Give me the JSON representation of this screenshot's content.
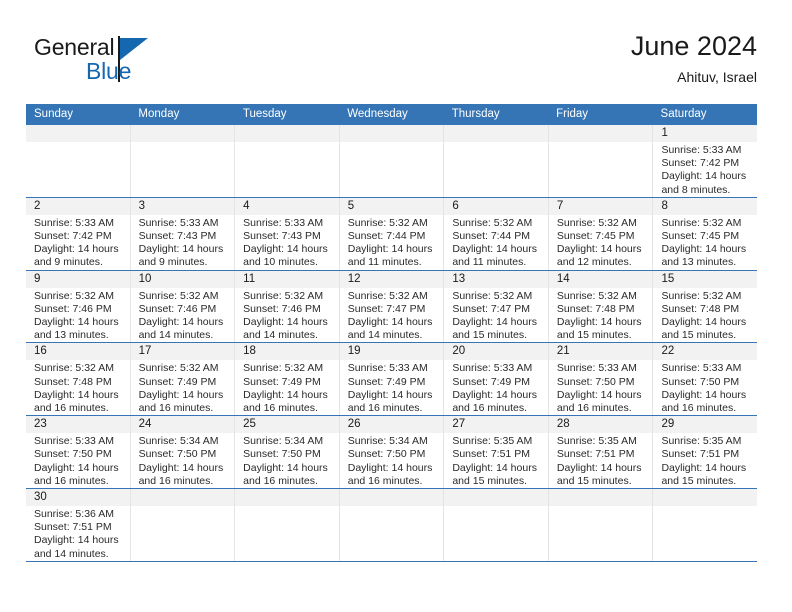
{
  "brand": {
    "name_top": "General",
    "name_bottom": "Blue",
    "triangle_icon": "triangle-icon",
    "accent_color": "#1567b0"
  },
  "header": {
    "month_title": "June 2024",
    "location": "Ahituv, Israel"
  },
  "theme": {
    "header_blue": "#3575b5",
    "daynum_band": "#f2f2f2",
    "text": "#1a1a1a"
  },
  "calendar": {
    "weekday_headers": [
      "Sunday",
      "Monday",
      "Tuesday",
      "Wednesday",
      "Thursday",
      "Friday",
      "Saturday"
    ],
    "weeks": [
      [
        {
          "day": "",
          "empty": true
        },
        {
          "day": "",
          "empty": true
        },
        {
          "day": "",
          "empty": true
        },
        {
          "day": "",
          "empty": true
        },
        {
          "day": "",
          "empty": true
        },
        {
          "day": "",
          "empty": true
        },
        {
          "day": "1",
          "sunrise": "Sunrise: 5:33 AM",
          "sunset": "Sunset: 7:42 PM",
          "daylight1": "Daylight: 14 hours",
          "daylight2": "and 8 minutes."
        }
      ],
      [
        {
          "day": "2",
          "sunrise": "Sunrise: 5:33 AM",
          "sunset": "Sunset: 7:42 PM",
          "daylight1": "Daylight: 14 hours",
          "daylight2": "and 9 minutes."
        },
        {
          "day": "3",
          "sunrise": "Sunrise: 5:33 AM",
          "sunset": "Sunset: 7:43 PM",
          "daylight1": "Daylight: 14 hours",
          "daylight2": "and 9 minutes."
        },
        {
          "day": "4",
          "sunrise": "Sunrise: 5:33 AM",
          "sunset": "Sunset: 7:43 PM",
          "daylight1": "Daylight: 14 hours",
          "daylight2": "and 10 minutes."
        },
        {
          "day": "5",
          "sunrise": "Sunrise: 5:32 AM",
          "sunset": "Sunset: 7:44 PM",
          "daylight1": "Daylight: 14 hours",
          "daylight2": "and 11 minutes."
        },
        {
          "day": "6",
          "sunrise": "Sunrise: 5:32 AM",
          "sunset": "Sunset: 7:44 PM",
          "daylight1": "Daylight: 14 hours",
          "daylight2": "and 11 minutes."
        },
        {
          "day": "7",
          "sunrise": "Sunrise: 5:32 AM",
          "sunset": "Sunset: 7:45 PM",
          "daylight1": "Daylight: 14 hours",
          "daylight2": "and 12 minutes."
        },
        {
          "day": "8",
          "sunrise": "Sunrise: 5:32 AM",
          "sunset": "Sunset: 7:45 PM",
          "daylight1": "Daylight: 14 hours",
          "daylight2": "and 13 minutes."
        }
      ],
      [
        {
          "day": "9",
          "sunrise": "Sunrise: 5:32 AM",
          "sunset": "Sunset: 7:46 PM",
          "daylight1": "Daylight: 14 hours",
          "daylight2": "and 13 minutes."
        },
        {
          "day": "10",
          "sunrise": "Sunrise: 5:32 AM",
          "sunset": "Sunset: 7:46 PM",
          "daylight1": "Daylight: 14 hours",
          "daylight2": "and 14 minutes."
        },
        {
          "day": "11",
          "sunrise": "Sunrise: 5:32 AM",
          "sunset": "Sunset: 7:46 PM",
          "daylight1": "Daylight: 14 hours",
          "daylight2": "and 14 minutes."
        },
        {
          "day": "12",
          "sunrise": "Sunrise: 5:32 AM",
          "sunset": "Sunset: 7:47 PM",
          "daylight1": "Daylight: 14 hours",
          "daylight2": "and 14 minutes."
        },
        {
          "day": "13",
          "sunrise": "Sunrise: 5:32 AM",
          "sunset": "Sunset: 7:47 PM",
          "daylight1": "Daylight: 14 hours",
          "daylight2": "and 15 minutes."
        },
        {
          "day": "14",
          "sunrise": "Sunrise: 5:32 AM",
          "sunset": "Sunset: 7:48 PM",
          "daylight1": "Daylight: 14 hours",
          "daylight2": "and 15 minutes."
        },
        {
          "day": "15",
          "sunrise": "Sunrise: 5:32 AM",
          "sunset": "Sunset: 7:48 PM",
          "daylight1": "Daylight: 14 hours",
          "daylight2": "and 15 minutes."
        }
      ],
      [
        {
          "day": "16",
          "sunrise": "Sunrise: 5:32 AM",
          "sunset": "Sunset: 7:48 PM",
          "daylight1": "Daylight: 14 hours",
          "daylight2": "and 16 minutes."
        },
        {
          "day": "17",
          "sunrise": "Sunrise: 5:32 AM",
          "sunset": "Sunset: 7:49 PM",
          "daylight1": "Daylight: 14 hours",
          "daylight2": "and 16 minutes."
        },
        {
          "day": "18",
          "sunrise": "Sunrise: 5:32 AM",
          "sunset": "Sunset: 7:49 PM",
          "daylight1": "Daylight: 14 hours",
          "daylight2": "and 16 minutes."
        },
        {
          "day": "19",
          "sunrise": "Sunrise: 5:33 AM",
          "sunset": "Sunset: 7:49 PM",
          "daylight1": "Daylight: 14 hours",
          "daylight2": "and 16 minutes."
        },
        {
          "day": "20",
          "sunrise": "Sunrise: 5:33 AM",
          "sunset": "Sunset: 7:49 PM",
          "daylight1": "Daylight: 14 hours",
          "daylight2": "and 16 minutes."
        },
        {
          "day": "21",
          "sunrise": "Sunrise: 5:33 AM",
          "sunset": "Sunset: 7:50 PM",
          "daylight1": "Daylight: 14 hours",
          "daylight2": "and 16 minutes."
        },
        {
          "day": "22",
          "sunrise": "Sunrise: 5:33 AM",
          "sunset": "Sunset: 7:50 PM",
          "daylight1": "Daylight: 14 hours",
          "daylight2": "and 16 minutes."
        }
      ],
      [
        {
          "day": "23",
          "sunrise": "Sunrise: 5:33 AM",
          "sunset": "Sunset: 7:50 PM",
          "daylight1": "Daylight: 14 hours",
          "daylight2": "and 16 minutes."
        },
        {
          "day": "24",
          "sunrise": "Sunrise: 5:34 AM",
          "sunset": "Sunset: 7:50 PM",
          "daylight1": "Daylight: 14 hours",
          "daylight2": "and 16 minutes."
        },
        {
          "day": "25",
          "sunrise": "Sunrise: 5:34 AM",
          "sunset": "Sunset: 7:50 PM",
          "daylight1": "Daylight: 14 hours",
          "daylight2": "and 16 minutes."
        },
        {
          "day": "26",
          "sunrise": "Sunrise: 5:34 AM",
          "sunset": "Sunset: 7:50 PM",
          "daylight1": "Daylight: 14 hours",
          "daylight2": "and 16 minutes."
        },
        {
          "day": "27",
          "sunrise": "Sunrise: 5:35 AM",
          "sunset": "Sunset: 7:51 PM",
          "daylight1": "Daylight: 14 hours",
          "daylight2": "and 15 minutes."
        },
        {
          "day": "28",
          "sunrise": "Sunrise: 5:35 AM",
          "sunset": "Sunset: 7:51 PM",
          "daylight1": "Daylight: 14 hours",
          "daylight2": "and 15 minutes."
        },
        {
          "day": "29",
          "sunrise": "Sunrise: 5:35 AM",
          "sunset": "Sunset: 7:51 PM",
          "daylight1": "Daylight: 14 hours",
          "daylight2": "and 15 minutes."
        }
      ],
      [
        {
          "day": "30",
          "sunrise": "Sunrise: 5:36 AM",
          "sunset": "Sunset: 7:51 PM",
          "daylight1": "Daylight: 14 hours",
          "daylight2": "and 14 minutes."
        },
        {
          "day": "",
          "empty": true
        },
        {
          "day": "",
          "empty": true
        },
        {
          "day": "",
          "empty": true
        },
        {
          "day": "",
          "empty": true
        },
        {
          "day": "",
          "empty": true
        },
        {
          "day": "",
          "empty": true
        }
      ]
    ]
  }
}
